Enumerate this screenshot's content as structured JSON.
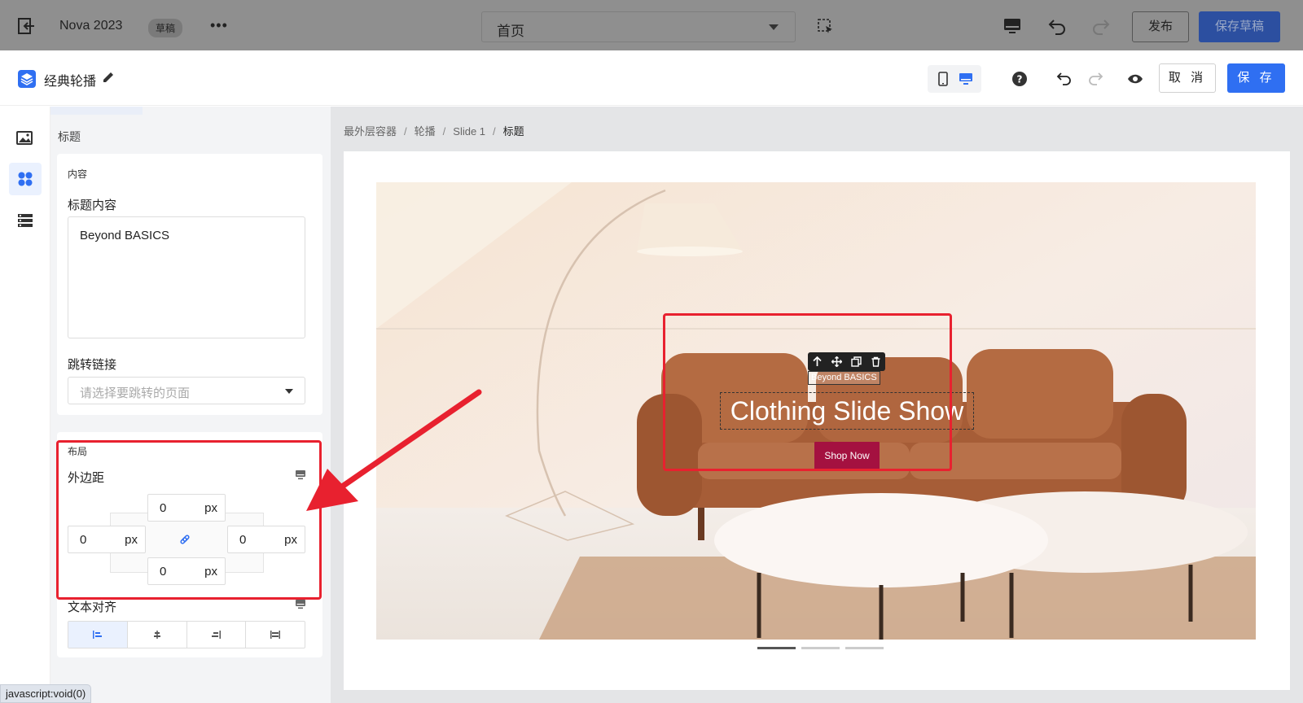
{
  "topbar": {
    "site_name": "Nova 2023",
    "status_badge": "草稿",
    "more": "•••",
    "page_select": "首页",
    "publish": "发布",
    "save_draft": "保存草稿"
  },
  "editor": {
    "title": "经典轮播",
    "cancel": "取 消",
    "save": "保 存"
  },
  "panel": {
    "section_title": "标题",
    "content": {
      "caption": "内容",
      "title_label": "标题内容",
      "title_value": "Beyond BASICS",
      "link_label": "跳转链接",
      "link_placeholder": "请选择要跳转的页面"
    },
    "layout": {
      "caption": "布局",
      "margin_label": "外边距",
      "margin_top": "0",
      "margin_left": "0",
      "margin_right": "0",
      "margin_bottom": "0",
      "unit": "px",
      "align_label": "文本对齐"
    }
  },
  "status_bar": "javascript:void(0)",
  "breadcrumb": [
    "最外层容器",
    "轮播",
    "Slide 1",
    "标题"
  ],
  "slide": {
    "subtitle": "Beyond BASICS",
    "headline": "Clothing Slide Show",
    "button": "Shop Now",
    "indicator_count": 3,
    "active_indicator": 0
  },
  "colors": {
    "primary": "#2f6ff2",
    "highlight": "#e8212f",
    "shop_button": "#a41140"
  }
}
